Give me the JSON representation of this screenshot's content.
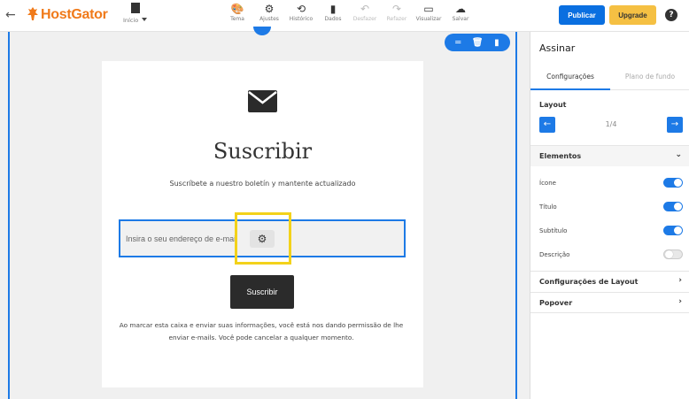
{
  "topbar": {
    "brand": "HostGator",
    "page_menu_label": "Início",
    "tools": [
      {
        "label": "Tema",
        "icon": "palette-icon",
        "glyph": "🎨",
        "disabled": false
      },
      {
        "label": "Ajustes",
        "icon": "gear-icon",
        "glyph": "⚙",
        "disabled": false
      },
      {
        "label": "Histórico",
        "icon": "history-icon",
        "glyph": "⟲",
        "disabled": false
      },
      {
        "label": "Dados",
        "icon": "bar-chart-icon",
        "glyph": "▮",
        "disabled": false
      },
      {
        "label": "Desfazer",
        "icon": "undo-icon",
        "glyph": "↶",
        "disabled": true
      },
      {
        "label": "Refazer",
        "icon": "redo-icon",
        "glyph": "↷",
        "disabled": true
      },
      {
        "label": "Visualizar",
        "icon": "monitor-icon",
        "glyph": "▭",
        "disabled": false
      },
      {
        "label": "Salvar",
        "icon": "cloud-icon",
        "glyph": "☁",
        "disabled": false
      }
    ],
    "publish_label": "Publicar",
    "upgrade_label": "Upgrade",
    "help_glyph": "?"
  },
  "block": {
    "title": "Suscribir",
    "subtitle": "Suscríbete a nuestro boletín y mantente actualizado",
    "email_placeholder": "Insira o seu endereço de e-mail",
    "submit_label": "Suscribir",
    "consent": "Ao marcar esta caixa e enviar suas informações, você está nos dando permissão de lhe enviar e-mails. Você pode cancelar a qualquer momento."
  },
  "panel": {
    "title": "Assinar",
    "tabs": [
      "Configurações",
      "Plano de fundo"
    ],
    "layout_label": "Layout",
    "layout_value": "1/4",
    "elements_label": "Elementos",
    "elements": [
      {
        "label": "Ícone",
        "on": true
      },
      {
        "label": "Título",
        "on": true
      },
      {
        "label": "Subtítulo",
        "on": true
      },
      {
        "label": "Descrição",
        "on": false
      }
    ],
    "layout_settings_label": "Configurações de Layout",
    "popover_label": "Popover"
  },
  "colors": {
    "accent": "#1d7ae6",
    "brand": "#f07a1a",
    "upgrade": "#f5c043",
    "highlight": "#f3d21a"
  }
}
